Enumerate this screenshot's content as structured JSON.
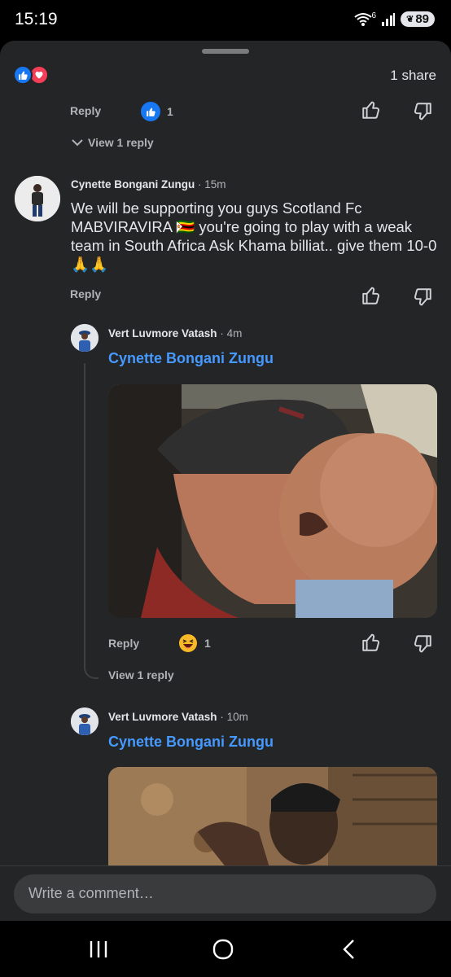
{
  "status": {
    "time": "15:19",
    "network": "6",
    "battery": "89"
  },
  "post_summary": {
    "share_count": "1 share"
  },
  "prev_comment": {
    "reply": "Reply",
    "reaction_count": "1",
    "view_replies": "View 1 reply"
  },
  "comment": {
    "author": "Cynette Bongani Zungu",
    "time": "· 15m",
    "text_line1": "We will be supporting you guys Scotland Fc",
    "text_line2": "MABVIRAVIRA 🇿🇼 you're going to play with a weak",
    "text_line3": "team in South Africa Ask Khama billiat.. give them 10-0",
    "text_line4": "🙏🙏",
    "reply": "Reply"
  },
  "replies": [
    {
      "author": "Vert Luvmore Vatash",
      "time": "· 4m",
      "mention": "Cynette Bongani Zungu",
      "reply": "Reply",
      "reaction_count": "1",
      "reaction_icon": "haha-emoji-icon",
      "view_replies": "View 1 reply"
    },
    {
      "author": "Vert Luvmore Vatash",
      "time": "· 10m",
      "mention": "Cynette Bongani Zungu"
    }
  ],
  "composer": {
    "placeholder": "Write a comment…"
  },
  "colors": {
    "sheet_bg": "#242526",
    "mention": "#4599ff",
    "like_blue": "#1877f2",
    "love_red": "#f33e58"
  }
}
